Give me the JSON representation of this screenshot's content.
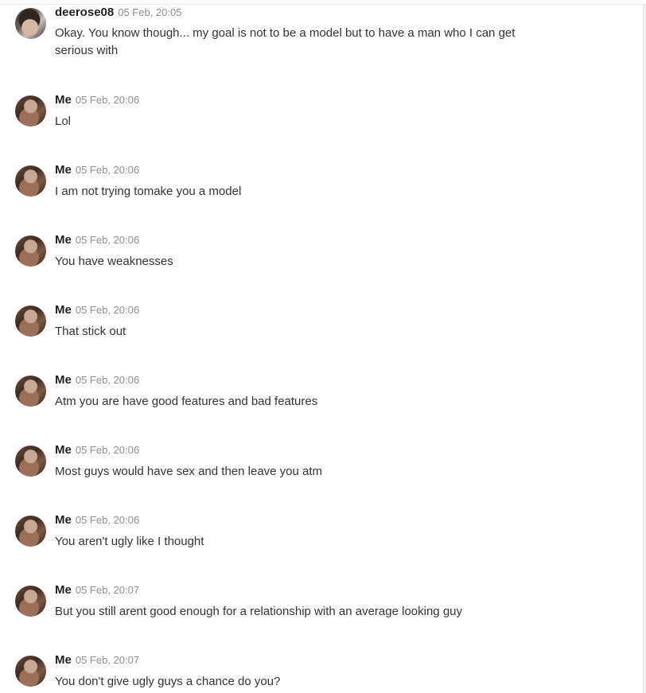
{
  "messages": [
    {
      "sender": "deerose08",
      "time": "05 Feb, 20:05",
      "text": "Okay. You know though... my goal is not to be a model but to have a man who I can get serious with",
      "avatar": "other-user-avatar"
    },
    {
      "sender": "Me",
      "time": "05 Feb, 20:06",
      "text": "Lol",
      "avatar": "my-avatar"
    },
    {
      "sender": "Me",
      "time": "05 Feb, 20:06",
      "text": "I am not trying tomake you a model",
      "avatar": "my-avatar"
    },
    {
      "sender": "Me",
      "time": "05 Feb, 20:06",
      "text": "You have weaknesses",
      "avatar": "my-avatar"
    },
    {
      "sender": "Me",
      "time": "05 Feb, 20:06",
      "text": "That stick out",
      "avatar": "my-avatar"
    },
    {
      "sender": "Me",
      "time": "05 Feb, 20:06",
      "text": "Atm you are have good features and bad features",
      "avatar": "my-avatar"
    },
    {
      "sender": "Me",
      "time": "05 Feb, 20:06",
      "text": "Most guys would have sex and then leave you atm",
      "avatar": "my-avatar"
    },
    {
      "sender": "Me",
      "time": "05 Feb, 20:06",
      "text": "You aren't ugly like I thought",
      "avatar": "my-avatar"
    },
    {
      "sender": "Me",
      "time": "05 Feb, 20:07",
      "text": "But you still arent good enough for a relationship with an average looking guy",
      "avatar": "my-avatar"
    },
    {
      "sender": "Me",
      "time": "05 Feb, 20:07",
      "text": "You don't give ugly guys a chance do you?",
      "avatar": "my-avatar"
    }
  ]
}
